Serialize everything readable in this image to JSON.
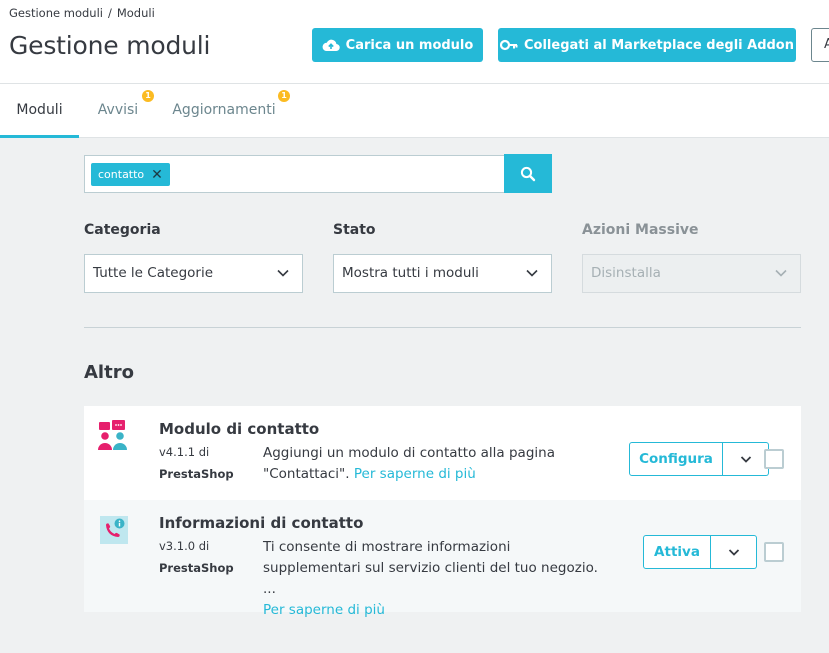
{
  "breadcrumb": [
    "Gestione moduli",
    "Moduli"
  ],
  "page_title": "Gestione moduli",
  "toolbar": {
    "upload_label": "Carica un modulo",
    "marketplace_label": "Collegati al Marketplace degli Addon",
    "cut_button_label": "A"
  },
  "tabs": [
    {
      "label": "Moduli",
      "active": true
    },
    {
      "label": "Avvisi",
      "badge": "1"
    },
    {
      "label": "Aggiornamenti",
      "badge": "1"
    }
  ],
  "search": {
    "tag": "contatto"
  },
  "filters": {
    "categoria": {
      "label": "Categoria",
      "value": "Tutte le Categorie"
    },
    "stato": {
      "label": "Stato",
      "value": "Mostra tutti i moduli"
    },
    "azioni": {
      "label": "Azioni Massive",
      "value": "Disinstalla"
    }
  },
  "section_title": "Altro",
  "modules": [
    {
      "name": "Modulo di contatto",
      "version": "v4.1.1 di",
      "author": "PrestaShop",
      "description": "Aggiungi un modulo di contatto alla pagina \"Contattaci\".",
      "more_link": "Per saperne di più",
      "action": "Configura"
    },
    {
      "name": "Informazioni di contatto",
      "version": "v3.1.0 di",
      "author": "PrestaShop",
      "description": "Ti consente di mostrare informazioni supplementari sul servizio clienti del tuo negozio. ...",
      "more_link": "Per saperne di più",
      "action": "Attiva"
    }
  ],
  "colors": {
    "accent": "#25b9d7",
    "badge": "#fbbb22",
    "icon_pink": "#e6206d",
    "icon_teal": "#3ab3c7"
  }
}
